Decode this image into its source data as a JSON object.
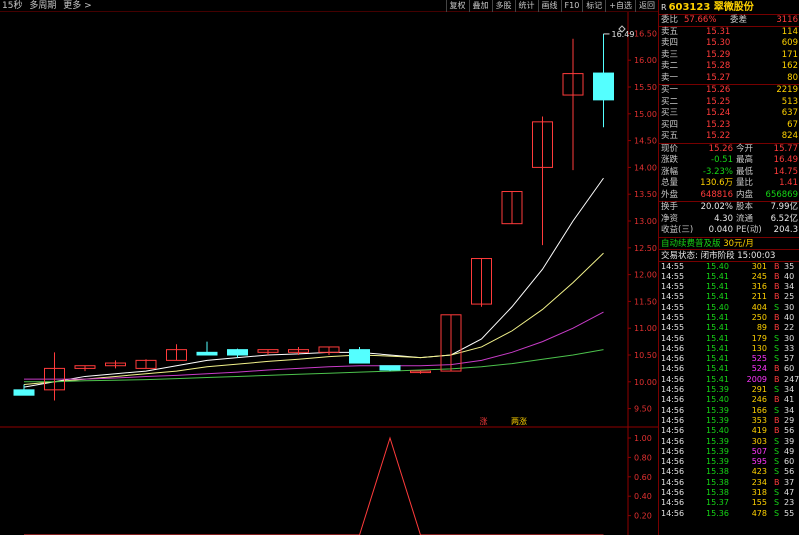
{
  "topbar": {
    "left": [
      "15秒",
      "多周期",
      "更多 >"
    ],
    "buttons": [
      "复权",
      "叠加",
      "多股",
      "统计",
      "画线",
      "F10",
      "标记",
      "+自选",
      "返回"
    ]
  },
  "colors": {
    "up": "#ff3b3b",
    "down": "#16d616",
    "bar_down_fill": "#54ffff",
    "ma1": "#ffffff",
    "ma2": "#f2f28a",
    "ma3": "#c83cc8",
    "ma4": "#4cc24c",
    "axis": "#900000"
  },
  "chart_data": {
    "type": "candlestick",
    "price_axis": [
      "16.50",
      "16.00",
      "15.50",
      "15.00",
      "14.50",
      "14.00",
      "13.50",
      "13.00",
      "12.50",
      "12.00",
      "11.50",
      "11.00",
      "10.50",
      "10.00",
      "9.50"
    ],
    "ylim": [
      9.25,
      16.75
    ],
    "high_annotation": "16.49",
    "candles": [
      {
        "o": 9.85,
        "h": 9.95,
        "l": 9.8,
        "c": 9.75
      },
      {
        "o": 9.85,
        "h": 10.55,
        "l": 9.65,
        "c": 10.25
      },
      {
        "o": 10.25,
        "h": 10.3,
        "l": 10.2,
        "c": 10.3
      },
      {
        "o": 10.3,
        "h": 10.4,
        "l": 10.25,
        "c": 10.35
      },
      {
        "o": 10.25,
        "h": 10.42,
        "l": 10.25,
        "c": 10.4
      },
      {
        "o": 10.4,
        "h": 10.7,
        "l": 10.4,
        "c": 10.6
      },
      {
        "o": 10.55,
        "h": 10.75,
        "l": 10.5,
        "c": 10.5
      },
      {
        "o": 10.6,
        "h": 10.62,
        "l": 10.45,
        "c": 10.5
      },
      {
        "o": 10.55,
        "h": 10.6,
        "l": 10.5,
        "c": 10.6
      },
      {
        "o": 10.55,
        "h": 10.65,
        "l": 10.5,
        "c": 10.6
      },
      {
        "o": 10.55,
        "h": 10.65,
        "l": 10.5,
        "c": 10.65
      },
      {
        "o": 10.6,
        "h": 10.65,
        "l": 10.5,
        "c": 10.35
      },
      {
        "o": 10.3,
        "h": 10.3,
        "l": 10.2,
        "c": 10.22
      },
      {
        "o": 10.2,
        "h": 10.2,
        "l": 10.15,
        "c": 10.2
      },
      {
        "o": 10.2,
        "h": 11.25,
        "l": 10.2,
        "c": 11.25
      },
      {
        "o": 11.45,
        "h": 12.3,
        "l": 11.4,
        "c": 12.3
      },
      {
        "o": 12.95,
        "h": 13.55,
        "l": 12.95,
        "c": 13.55
      },
      {
        "o": 14.0,
        "h": 14.95,
        "l": 12.55,
        "c": 14.85
      },
      {
        "o": 15.35,
        "h": 16.4,
        "l": 13.95,
        "c": 15.75
      },
      {
        "o": 15.76,
        "h": 16.49,
        "l": 14.75,
        "c": 15.26
      }
    ],
    "ma": [
      {
        "color": "#ffffff",
        "values": [
          9.9,
          10.0,
          10.1,
          10.15,
          10.2,
          10.3,
          10.4,
          10.45,
          10.5,
          10.52,
          10.55,
          10.55,
          10.5,
          10.45,
          10.5,
          10.8,
          11.4,
          12.1,
          13.0,
          13.8
        ]
      },
      {
        "color": "#f2f28a",
        "values": [
          9.95,
          10.0,
          10.05,
          10.1,
          10.15,
          10.2,
          10.28,
          10.33,
          10.38,
          10.42,
          10.47,
          10.5,
          10.48,
          10.45,
          10.5,
          10.65,
          10.95,
          11.35,
          11.85,
          12.4
        ]
      },
      {
        "color": "#c83cc8",
        "values": [
          10.05,
          10.05,
          10.05,
          10.07,
          10.1,
          10.12,
          10.15,
          10.18,
          10.22,
          10.25,
          10.28,
          10.3,
          10.3,
          10.3,
          10.32,
          10.4,
          10.55,
          10.75,
          11.0,
          11.3
        ]
      },
      {
        "color": "#4cc24c",
        "values": [
          10.0,
          10.0,
          10.02,
          10.03,
          10.04,
          10.06,
          10.08,
          10.1,
          10.12,
          10.14,
          10.16,
          10.18,
          10.2,
          10.22,
          10.24,
          10.28,
          10.34,
          10.42,
          10.5,
          10.6
        ]
      }
    ],
    "markers": [
      "涨",
      "两涨"
    ],
    "sub_axis": [
      "1.00",
      "0.80",
      "0.60",
      "0.40",
      "0.20"
    ],
    "sub_ylim": [
      0,
      1.0
    ],
    "sub_series": [
      0,
      0,
      0,
      0,
      0,
      0,
      0,
      0,
      0,
      0,
      0,
      0,
      1.0,
      0,
      0,
      0,
      0,
      0,
      0,
      0
    ]
  },
  "quote": {
    "code": "603123",
    "name": "翠微股份",
    "header_right": "R",
    "weibi_label": "委比",
    "weibi": "57.66%",
    "weicha_label": "委差",
    "weicha": "3116",
    "asks": [
      {
        "label": "卖五",
        "price": "15.31",
        "vol": "114"
      },
      {
        "label": "卖四",
        "price": "15.30",
        "vol": "609"
      },
      {
        "label": "卖三",
        "price": "15.29",
        "vol": "171"
      },
      {
        "label": "卖二",
        "price": "15.28",
        "vol": "162"
      },
      {
        "label": "卖一",
        "price": "15.27",
        "vol": "80"
      }
    ],
    "bids": [
      {
        "label": "买一",
        "price": "15.26",
        "vol": "2219"
      },
      {
        "label": "买二",
        "price": "15.25",
        "vol": "513"
      },
      {
        "label": "买三",
        "price": "15.24",
        "vol": "637"
      },
      {
        "label": "买四",
        "price": "15.23",
        "vol": "67"
      },
      {
        "label": "买五",
        "price": "15.22",
        "vol": "824"
      }
    ],
    "stats": [
      {
        "l1": "现价",
        "v1": "15.26",
        "c1": "red",
        "l2": "今开",
        "v2": "15.77",
        "c2": "red"
      },
      {
        "l1": "涨跌",
        "v1": "-0.51",
        "c1": "green",
        "l2": "最高",
        "v2": "16.49",
        "c2": "red"
      },
      {
        "l1": "涨幅",
        "v1": "-3.23%",
        "c1": "green",
        "l2": "最低",
        "v2": "14.75",
        "c2": "red"
      },
      {
        "l1": "总量",
        "v1": "130.6万",
        "c1": "yel",
        "l2": "量比",
        "v2": "1.41",
        "c2": "red"
      },
      {
        "l1": "外盘",
        "v1": "648816",
        "c1": "red",
        "l2": "内盘",
        "v2": "656869",
        "c2": "green"
      }
    ],
    "stats2": [
      {
        "l1": "换手",
        "v1": "20.02%",
        "c1": "wht",
        "l2": "股本",
        "v2": "7.99亿",
        "c2": "wht"
      },
      {
        "l1": "净资",
        "v1": "4.30",
        "c1": "wht",
        "l2": "流通",
        "v2": "6.52亿",
        "c2": "wht"
      },
      {
        "l1": "收益(三)",
        "v1": "0.040",
        "c1": "wht",
        "l2": "PE(动)",
        "v2": "204.3",
        "c2": "wht"
      }
    ],
    "promo": "自动续费普及版",
    "promo_price": "30元/月",
    "status": "交易状态: 闭市阶段 15:00:03"
  },
  "ticks": [
    {
      "t": "14:55",
      "p": "15.40",
      "v": "301",
      "d": "B",
      "n": "35"
    },
    {
      "t": "14:55",
      "p": "15.41",
      "v": "245",
      "d": "B",
      "n": "40"
    },
    {
      "t": "14:55",
      "p": "15.41",
      "v": "316",
      "d": "B",
      "n": "34"
    },
    {
      "t": "14:55",
      "p": "15.41",
      "v": "211",
      "d": "B",
      "n": "25"
    },
    {
      "t": "14:55",
      "p": "15.40",
      "v": "404",
      "d": "S",
      "n": "30"
    },
    {
      "t": "14:55",
      "p": "15.41",
      "v": "250",
      "d": "B",
      "n": "40"
    },
    {
      "t": "14:55",
      "p": "15.41",
      "v": "89",
      "d": "B",
      "n": "22"
    },
    {
      "t": "14:56",
      "p": "15.41",
      "v": "179",
      "d": "S",
      "n": "30"
    },
    {
      "t": "14:56",
      "p": "15.41",
      "v": "130",
      "d": "S",
      "n": "33"
    },
    {
      "t": "14:56",
      "p": "15.41",
      "v": "525",
      "d": "S",
      "n": "57"
    },
    {
      "t": "14:56",
      "p": "15.41",
      "v": "524",
      "d": "B",
      "n": "60"
    },
    {
      "t": "14:56",
      "p": "15.41",
      "v": "2009",
      "d": "B",
      "n": "247"
    },
    {
      "t": "14:56",
      "p": "15.39",
      "v": "291",
      "d": "S",
      "n": "34"
    },
    {
      "t": "14:56",
      "p": "15.40",
      "v": "246",
      "d": "B",
      "n": "41"
    },
    {
      "t": "14:56",
      "p": "15.39",
      "v": "166",
      "d": "S",
      "n": "34"
    },
    {
      "t": "14:56",
      "p": "15.39",
      "v": "353",
      "d": "B",
      "n": "29"
    },
    {
      "t": "14:56",
      "p": "15.40",
      "v": "419",
      "d": "B",
      "n": "56"
    },
    {
      "t": "14:56",
      "p": "15.39",
      "v": "303",
      "d": "S",
      "n": "39"
    },
    {
      "t": "14:56",
      "p": "15.39",
      "v": "507",
      "d": "S",
      "n": "49"
    },
    {
      "t": "14:56",
      "p": "15.39",
      "v": "595",
      "d": "S",
      "n": "60"
    },
    {
      "t": "14:56",
      "p": "15.38",
      "v": "423",
      "d": "S",
      "n": "56"
    },
    {
      "t": "14:56",
      "p": "15.38",
      "v": "234",
      "d": "B",
      "n": "37"
    },
    {
      "t": "14:56",
      "p": "15.38",
      "v": "318",
      "d": "S",
      "n": "47"
    },
    {
      "t": "14:56",
      "p": "15.37",
      "v": "155",
      "d": "S",
      "n": "23"
    },
    {
      "t": "14:56",
      "p": "15.36",
      "v": "478",
      "d": "S",
      "n": "55"
    }
  ]
}
